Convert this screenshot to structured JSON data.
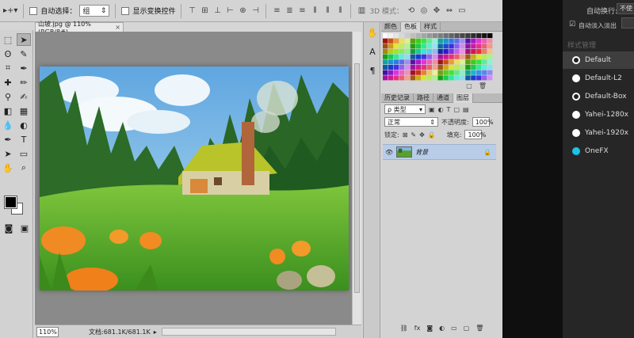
{
  "options_bar": {
    "auto_select_label": "自动选择：",
    "auto_select_value": "组",
    "show_transform_label": "显示变换控件",
    "mode_3d_label": "3D 模式："
  },
  "document": {
    "tab_title": "山坡.jpg @ 110%(RGB/8#)",
    "zoom": "110%",
    "doc_info": "文档:681.1K/681.1K"
  },
  "swatch_panel": {
    "tabs": [
      "颜色",
      "色板",
      "样式"
    ],
    "active_tab": "色板"
  },
  "layers_panel": {
    "tabs": [
      "历史记录",
      "路径",
      "通道",
      "图层"
    ],
    "active_tab": "图层",
    "filter_type": "ρ 类型",
    "blend_mode": "正常",
    "opacity_label": "不透明度:",
    "opacity_value": "100%",
    "lock_label": "锁定:",
    "fill_label": "填充:",
    "fill_value": "100%",
    "layer_name": "背景"
  },
  "right_app": {
    "auto_wrap_label": "自动换行:",
    "auto_wrap_value": "不使",
    "auto_fade_label": "自动淡入淡出",
    "style_header": "样式管理",
    "styles": [
      {
        "name": "Default",
        "selected": true,
        "dot": "ring"
      },
      {
        "name": "Default-L2",
        "dot": "white"
      },
      {
        "name": "Default-Box",
        "dot": "ring"
      },
      {
        "name": "Yahei-1280x",
        "dot": "white"
      },
      {
        "name": "Yahei-1920x",
        "dot": "white"
      },
      {
        "name": "OneFX",
        "dot": "cyan"
      }
    ]
  },
  "colors": {
    "panel_bg": "#d6d6d6",
    "selected_layer": "#b9cde9",
    "dark_app_bg": "#262626",
    "onefx_dot": "#19c4e6"
  }
}
